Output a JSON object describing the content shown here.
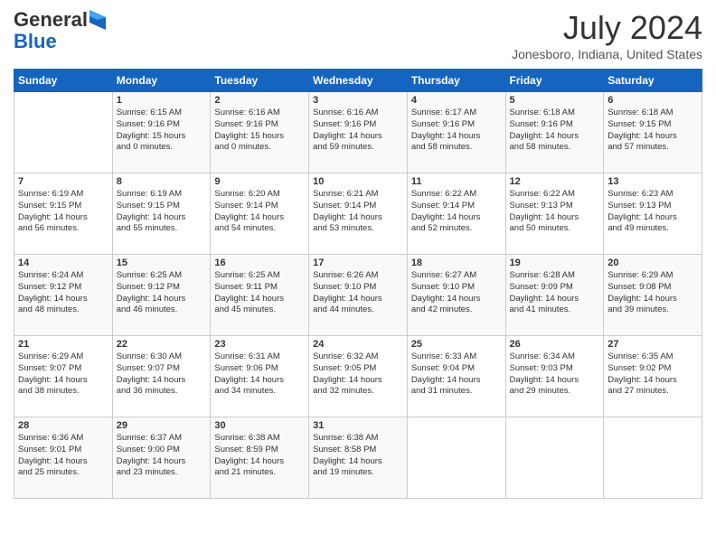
{
  "header": {
    "logo_general": "General",
    "logo_blue": "Blue",
    "month_title": "July 2024",
    "location": "Jonesboro, Indiana, United States"
  },
  "days_of_week": [
    "Sunday",
    "Monday",
    "Tuesday",
    "Wednesday",
    "Thursday",
    "Friday",
    "Saturday"
  ],
  "weeks": [
    [
      {
        "day": "",
        "content": ""
      },
      {
        "day": "1",
        "content": "Sunrise: 6:15 AM\nSunset: 9:16 PM\nDaylight: 15 hours\nand 0 minutes."
      },
      {
        "day": "2",
        "content": "Sunrise: 6:16 AM\nSunset: 9:16 PM\nDaylight: 15 hours\nand 0 minutes."
      },
      {
        "day": "3",
        "content": "Sunrise: 6:16 AM\nSunset: 9:16 PM\nDaylight: 14 hours\nand 59 minutes."
      },
      {
        "day": "4",
        "content": "Sunrise: 6:17 AM\nSunset: 9:16 PM\nDaylight: 14 hours\nand 58 minutes."
      },
      {
        "day": "5",
        "content": "Sunrise: 6:18 AM\nSunset: 9:16 PM\nDaylight: 14 hours\nand 58 minutes."
      },
      {
        "day": "6",
        "content": "Sunrise: 6:18 AM\nSunset: 9:15 PM\nDaylight: 14 hours\nand 57 minutes."
      }
    ],
    [
      {
        "day": "7",
        "content": "Sunrise: 6:19 AM\nSunset: 9:15 PM\nDaylight: 14 hours\nand 56 minutes."
      },
      {
        "day": "8",
        "content": "Sunrise: 6:19 AM\nSunset: 9:15 PM\nDaylight: 14 hours\nand 55 minutes."
      },
      {
        "day": "9",
        "content": "Sunrise: 6:20 AM\nSunset: 9:14 PM\nDaylight: 14 hours\nand 54 minutes."
      },
      {
        "day": "10",
        "content": "Sunrise: 6:21 AM\nSunset: 9:14 PM\nDaylight: 14 hours\nand 53 minutes."
      },
      {
        "day": "11",
        "content": "Sunrise: 6:22 AM\nSunset: 9:14 PM\nDaylight: 14 hours\nand 52 minutes."
      },
      {
        "day": "12",
        "content": "Sunrise: 6:22 AM\nSunset: 9:13 PM\nDaylight: 14 hours\nand 50 minutes."
      },
      {
        "day": "13",
        "content": "Sunrise: 6:23 AM\nSunset: 9:13 PM\nDaylight: 14 hours\nand 49 minutes."
      }
    ],
    [
      {
        "day": "14",
        "content": "Sunrise: 6:24 AM\nSunset: 9:12 PM\nDaylight: 14 hours\nand 48 minutes."
      },
      {
        "day": "15",
        "content": "Sunrise: 6:25 AM\nSunset: 9:12 PM\nDaylight: 14 hours\nand 46 minutes."
      },
      {
        "day": "16",
        "content": "Sunrise: 6:25 AM\nSunset: 9:11 PM\nDaylight: 14 hours\nand 45 minutes."
      },
      {
        "day": "17",
        "content": "Sunrise: 6:26 AM\nSunset: 9:10 PM\nDaylight: 14 hours\nand 44 minutes."
      },
      {
        "day": "18",
        "content": "Sunrise: 6:27 AM\nSunset: 9:10 PM\nDaylight: 14 hours\nand 42 minutes."
      },
      {
        "day": "19",
        "content": "Sunrise: 6:28 AM\nSunset: 9:09 PM\nDaylight: 14 hours\nand 41 minutes."
      },
      {
        "day": "20",
        "content": "Sunrise: 6:29 AM\nSunset: 9:08 PM\nDaylight: 14 hours\nand 39 minutes."
      }
    ],
    [
      {
        "day": "21",
        "content": "Sunrise: 6:29 AM\nSunset: 9:07 PM\nDaylight: 14 hours\nand 38 minutes."
      },
      {
        "day": "22",
        "content": "Sunrise: 6:30 AM\nSunset: 9:07 PM\nDaylight: 14 hours\nand 36 minutes."
      },
      {
        "day": "23",
        "content": "Sunrise: 6:31 AM\nSunset: 9:06 PM\nDaylight: 14 hours\nand 34 minutes."
      },
      {
        "day": "24",
        "content": "Sunrise: 6:32 AM\nSunset: 9:05 PM\nDaylight: 14 hours\nand 32 minutes."
      },
      {
        "day": "25",
        "content": "Sunrise: 6:33 AM\nSunset: 9:04 PM\nDaylight: 14 hours\nand 31 minutes."
      },
      {
        "day": "26",
        "content": "Sunrise: 6:34 AM\nSunset: 9:03 PM\nDaylight: 14 hours\nand 29 minutes."
      },
      {
        "day": "27",
        "content": "Sunrise: 6:35 AM\nSunset: 9:02 PM\nDaylight: 14 hours\nand 27 minutes."
      }
    ],
    [
      {
        "day": "28",
        "content": "Sunrise: 6:36 AM\nSunset: 9:01 PM\nDaylight: 14 hours\nand 25 minutes."
      },
      {
        "day": "29",
        "content": "Sunrise: 6:37 AM\nSunset: 9:00 PM\nDaylight: 14 hours\nand 23 minutes."
      },
      {
        "day": "30",
        "content": "Sunrise: 6:38 AM\nSunset: 8:59 PM\nDaylight: 14 hours\nand 21 minutes."
      },
      {
        "day": "31",
        "content": "Sunrise: 6:38 AM\nSunset: 8:58 PM\nDaylight: 14 hours\nand 19 minutes."
      },
      {
        "day": "",
        "content": ""
      },
      {
        "day": "",
        "content": ""
      },
      {
        "day": "",
        "content": ""
      }
    ]
  ]
}
